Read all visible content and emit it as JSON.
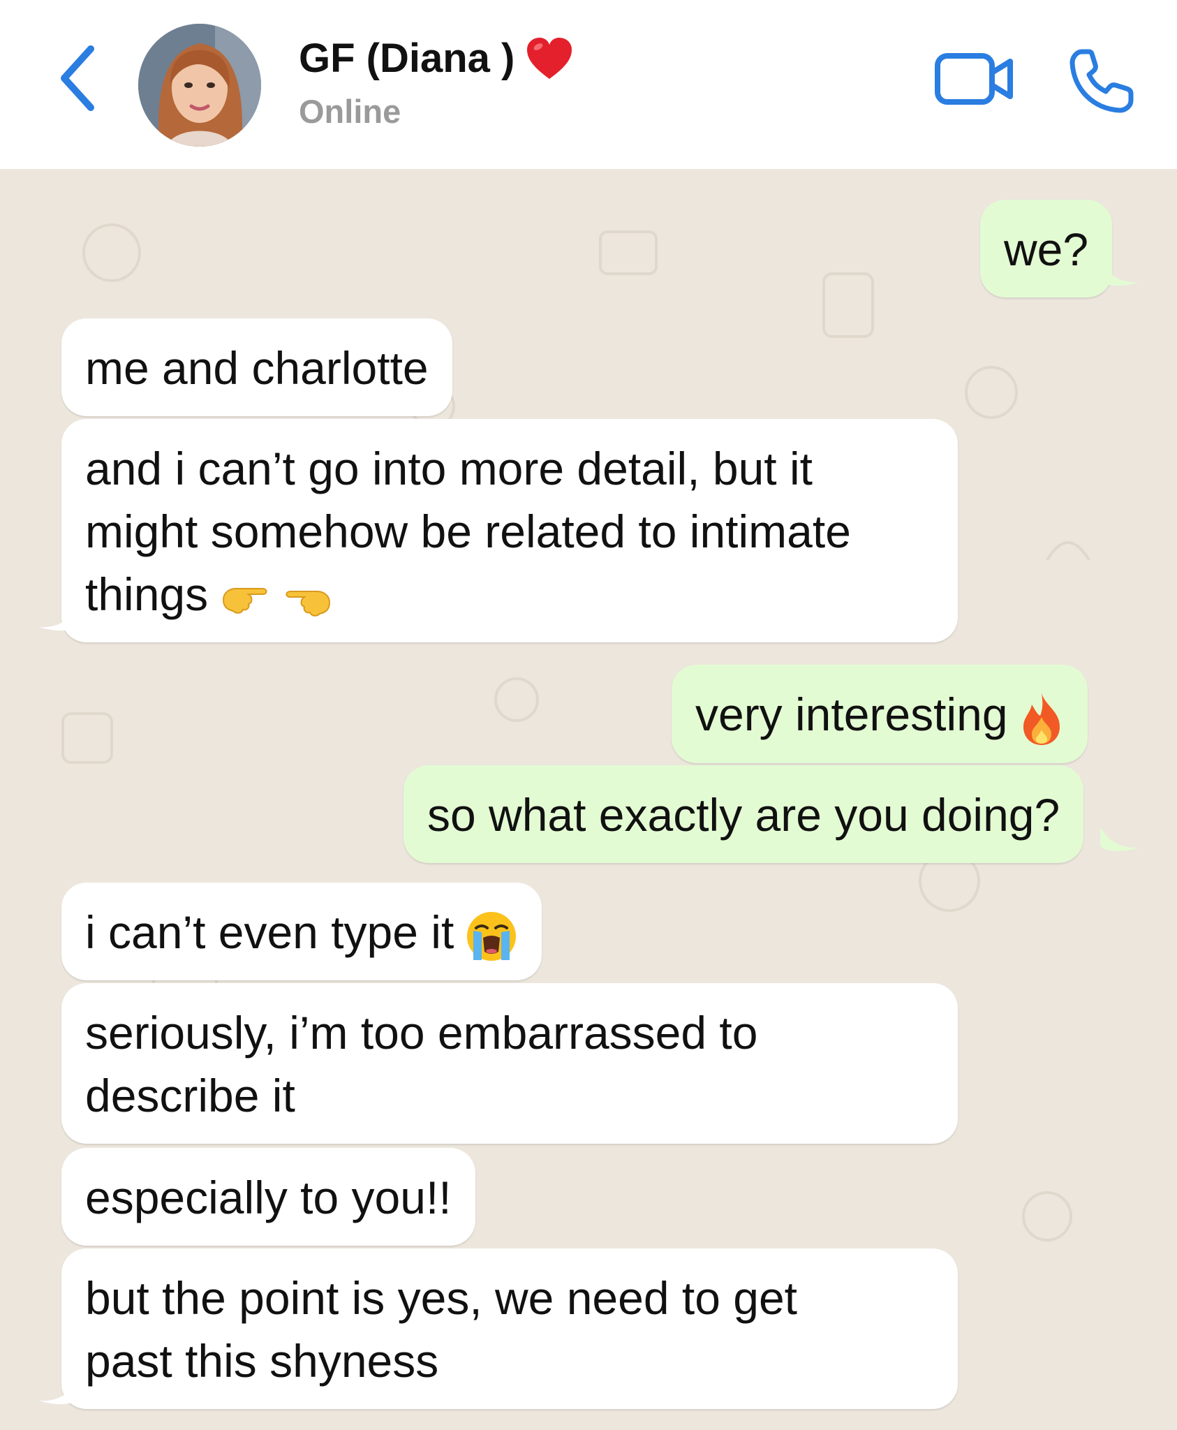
{
  "header": {
    "contact_name": "GF (Diana )",
    "status": "Online",
    "heart_icon": "red-heart-icon"
  },
  "colors": {
    "accent": "#2a7de1",
    "incoming_bubble": "#ffffff",
    "outgoing_bubble": "#e3fbd3",
    "chat_background": "#ece6dd"
  },
  "messages": [
    {
      "direction": "out",
      "text": "we?"
    },
    {
      "direction": "in",
      "text": "me and charlotte"
    },
    {
      "direction": "in",
      "lines": [
        "and i can’t go into more detail, but it",
        "might somehow be related to intimate",
        "things"
      ],
      "emoji": "pointing-fingers-emoji"
    },
    {
      "direction": "out",
      "text": "very interesting",
      "emoji": "fire-emoji"
    },
    {
      "direction": "out",
      "text": "so what exactly are you doing?"
    },
    {
      "direction": "in",
      "text": "i can’t even type it",
      "emoji": "loudly-crying-face-emoji"
    },
    {
      "direction": "in",
      "lines": [
        "seriously, i’m too embarrassed to",
        "describe it"
      ]
    },
    {
      "direction": "in",
      "text": "especially to you!!"
    },
    {
      "direction": "in",
      "lines": [
        "but the point is yes, we need to get",
        "past this shyness"
      ]
    }
  ]
}
